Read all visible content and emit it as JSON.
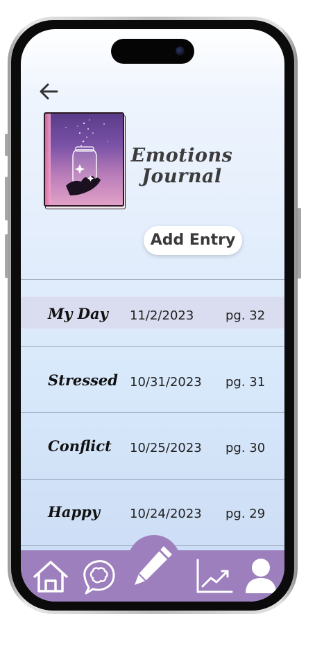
{
  "app": {
    "title": "Emotions Journal",
    "title_line1": "Emotions",
    "title_line2": "Journal"
  },
  "header": {
    "back_icon": "arrow-left-icon",
    "book_icon": "journal-book-cover-icon"
  },
  "actions": {
    "add_entry_label": "Add Entry"
  },
  "entries": [
    {
      "name": "My Day",
      "date": "11/2/2023",
      "page": "pg. 32",
      "selected": true
    },
    {
      "name": "Stressed",
      "date": "10/31/2023",
      "page": "pg. 31",
      "selected": false
    },
    {
      "name": "Conflict",
      "date": "10/25/2023",
      "page": "pg. 30",
      "selected": false
    },
    {
      "name": "Happy",
      "date": "10/24/2023",
      "page": "pg. 29",
      "selected": false
    }
  ],
  "nav": {
    "items": [
      {
        "icon": "home-icon"
      },
      {
        "icon": "brain-thought-icon"
      },
      {
        "icon": "pencil-icon",
        "active": true
      },
      {
        "icon": "trend-chart-icon"
      },
      {
        "icon": "user-profile-icon"
      }
    ]
  },
  "colors": {
    "nav_background": "#9d7fbd",
    "selected_row": "#dadcf0",
    "screen_top": "#ffffff",
    "screen_bottom": "#c9daf4"
  }
}
